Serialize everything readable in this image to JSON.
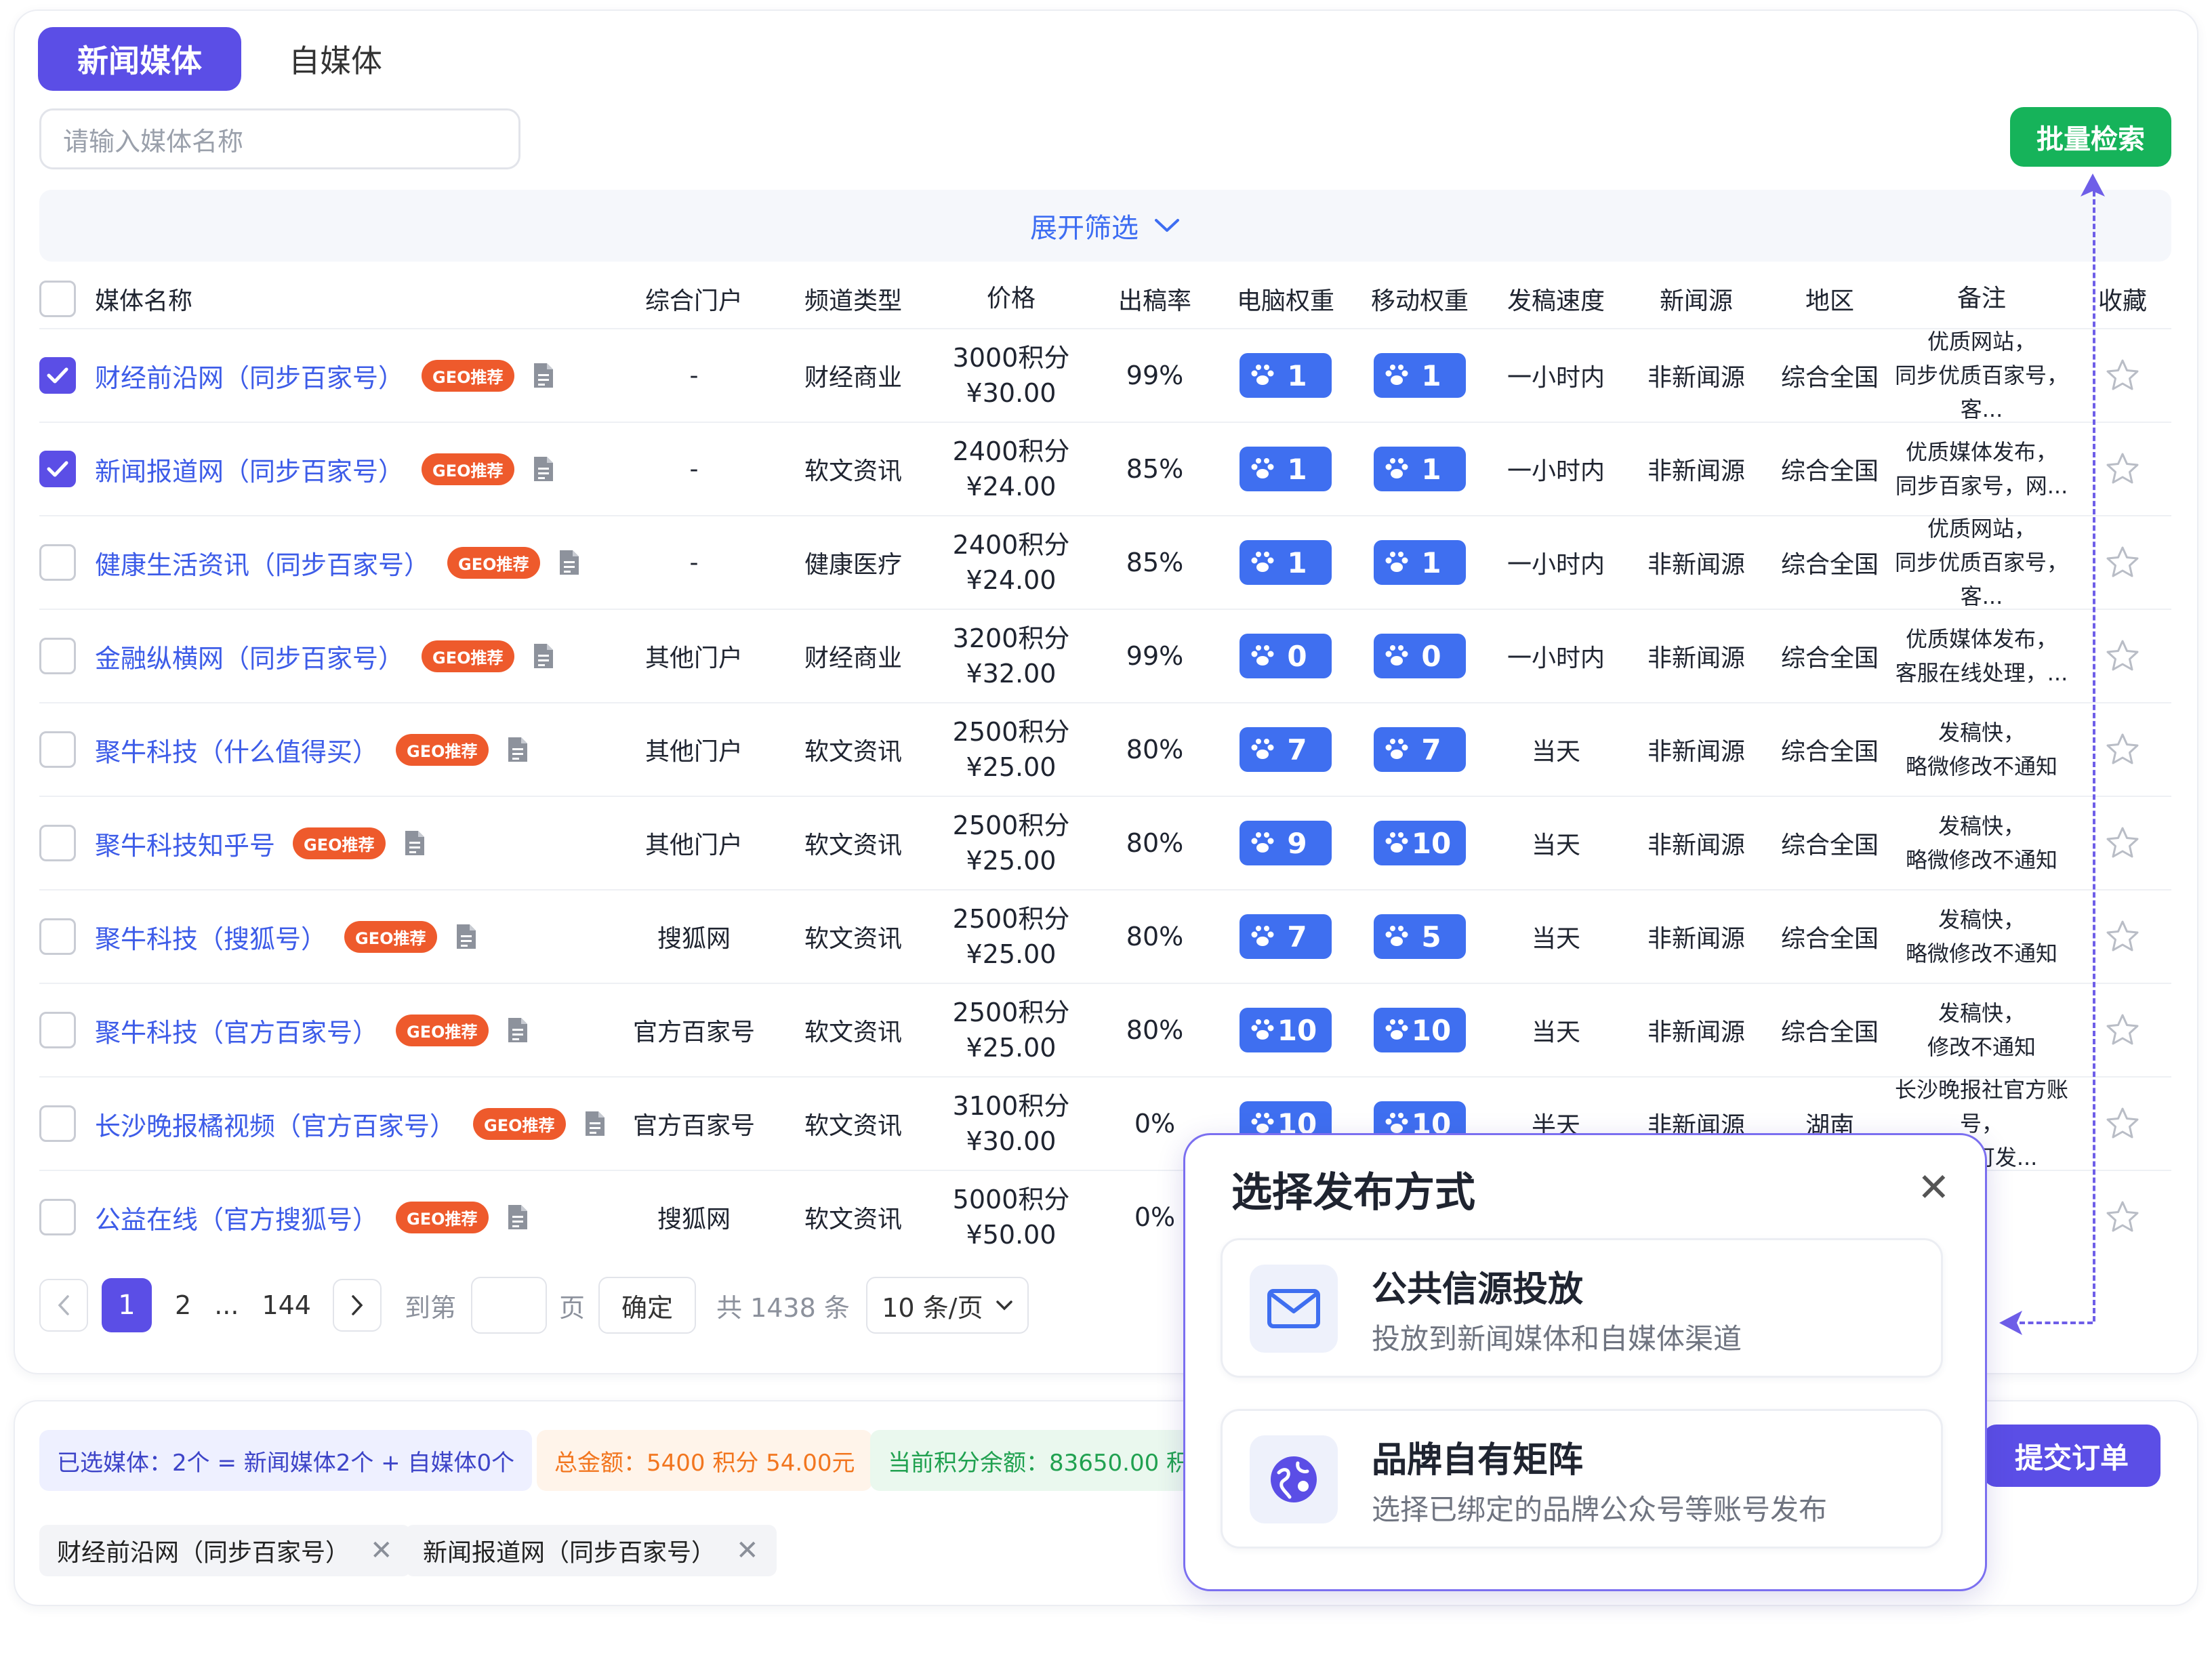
{
  "tabs": {
    "active": "新闻媒体",
    "other": "自媒体"
  },
  "search": {
    "placeholder": "请输入媒体名称"
  },
  "batch_search_label": "批量检索",
  "filter_toggle_label": "展开筛选",
  "columns": [
    "媒体名称",
    "综合门户",
    "频道类型",
    "价格",
    "出稿率",
    "电脑权重",
    "移动权重",
    "发稿速度",
    "新闻源",
    "地区",
    "备注",
    "收藏"
  ],
  "geo_badge": "GEO推荐",
  "rows": [
    {
      "checked": true,
      "name": "财经前沿网（同步百家号）",
      "portal": "-",
      "channel": "财经商业",
      "points": "3000积分",
      "price": "¥30.00",
      "rate": "99%",
      "pc": "1",
      "mobile": "1",
      "speed": "一小时内",
      "source": "非新闻源",
      "area": "综合全国",
      "note1": "优质网站，",
      "note2": "同步优质百家号，客..."
    },
    {
      "checked": true,
      "name": "新闻报道网（同步百家号）",
      "portal": "-",
      "channel": "软文资讯",
      "points": "2400积分",
      "price": "¥24.00",
      "rate": "85%",
      "pc": "1",
      "mobile": "1",
      "speed": "一小时内",
      "source": "非新闻源",
      "area": "综合全国",
      "note1": "优质媒体发布，",
      "note2": "同步百家号，网..."
    },
    {
      "checked": false,
      "name": "健康生活资讯（同步百家号）",
      "portal": "-",
      "channel": "健康医疗",
      "points": "2400积分",
      "price": "¥24.00",
      "rate": "85%",
      "pc": "1",
      "mobile": "1",
      "speed": "一小时内",
      "source": "非新闻源",
      "area": "综合全国",
      "note1": "优质网站，",
      "note2": "同步优质百家号，客..."
    },
    {
      "checked": false,
      "name": "金融纵横网（同步百家号）",
      "portal": "其他门户",
      "channel": "财经商业",
      "points": "3200积分",
      "price": "¥32.00",
      "rate": "99%",
      "pc": "0",
      "mobile": "0",
      "speed": "一小时内",
      "source": "非新闻源",
      "area": "综合全国",
      "note1": "优质媒体发布，",
      "note2": "客服在线处理，..."
    },
    {
      "checked": false,
      "name": "聚牛科技（什么值得买）",
      "portal": "其他门户",
      "channel": "软文资讯",
      "points": "2500积分",
      "price": "¥25.00",
      "rate": "80%",
      "pc": "7",
      "mobile": "7",
      "speed": "当天",
      "source": "非新闻源",
      "area": "综合全国",
      "note1": "发稿快，",
      "note2": "略微修改不通知"
    },
    {
      "checked": false,
      "name": "聚牛科技知乎号",
      "portal": "其他门户",
      "channel": "软文资讯",
      "points": "2500积分",
      "price": "¥25.00",
      "rate": "80%",
      "pc": "9",
      "mobile": "10",
      "speed": "当天",
      "source": "非新闻源",
      "area": "综合全国",
      "note1": "发稿快，",
      "note2": "略微修改不通知"
    },
    {
      "checked": false,
      "name": "聚牛科技（搜狐号）",
      "portal": "搜狐网",
      "channel": "软文资讯",
      "points": "2500积分",
      "price": "¥25.00",
      "rate": "80%",
      "pc": "7",
      "mobile": "5",
      "speed": "当天",
      "source": "非新闻源",
      "area": "综合全国",
      "note1": "发稿快，",
      "note2": "略微修改不通知"
    },
    {
      "checked": false,
      "name": "聚牛科技（官方百家号）",
      "portal": "官方百家号",
      "channel": "软文资讯",
      "points": "2500积分",
      "price": "¥25.00",
      "rate": "80%",
      "pc": "10",
      "mobile": "10",
      "speed": "当天",
      "source": "非新闻源",
      "area": "综合全国",
      "note1": "发稿快，",
      "note2": "修改不通知"
    },
    {
      "checked": false,
      "name": "长沙晚报橘视频（官方百家号）",
      "portal": "官方百家号",
      "channel": "软文资讯",
      "points": "3100积分",
      "price": "¥30.00",
      "rate": "0%",
      "pc": "10",
      "mobile": "10",
      "speed": "半天",
      "source": "非新闻源",
      "area": "湖南",
      "note1": "长沙晚报社官方账号，",
      "note2": "GEO可发..."
    },
    {
      "checked": false,
      "name": "公益在线（官方搜狐号）",
      "portal": "搜狐网",
      "channel": "软文资讯",
      "points": "5000积分",
      "price": "¥50.00",
      "rate": "0%",
      "pc": "",
      "mobile": "",
      "speed": "",
      "source": "",
      "area": "",
      "note1": "",
      "note2": ""
    }
  ],
  "pagination": {
    "current": "1",
    "page2": "2",
    "ellipsis": "...",
    "last": "144",
    "goto_label": "到第",
    "page_unit": "页",
    "confirm": "确定",
    "total": "共 1438 条",
    "page_size": "10 条/页"
  },
  "summary": {
    "selected": "已选媒体：2个 = 新闻媒体2个 + 自媒体0个",
    "amount": "总金额：5400 积分 54.00元",
    "balance": "当前积分余额：83650.00 积分",
    "chips": [
      "财经前沿网（同步百家号）",
      "新闻报道网（同步百家号）"
    ],
    "submit": "提交订单"
  },
  "modal": {
    "title": "选择发布方式",
    "options": [
      {
        "title": "公共信源投放",
        "desc": "投放到新闻媒体和自媒体渠道",
        "icon": "mail-icon"
      },
      {
        "title": "品牌自有矩阵",
        "desc": "选择已绑定的品牌公众号等账号发布",
        "icon": "globe-icon"
      }
    ]
  },
  "colors": {
    "primary": "#5b4ee6",
    "link": "#3d5ce8",
    "green": "#16b35a",
    "geo": "#ee5a2c",
    "weight": "#3f6ff0"
  }
}
